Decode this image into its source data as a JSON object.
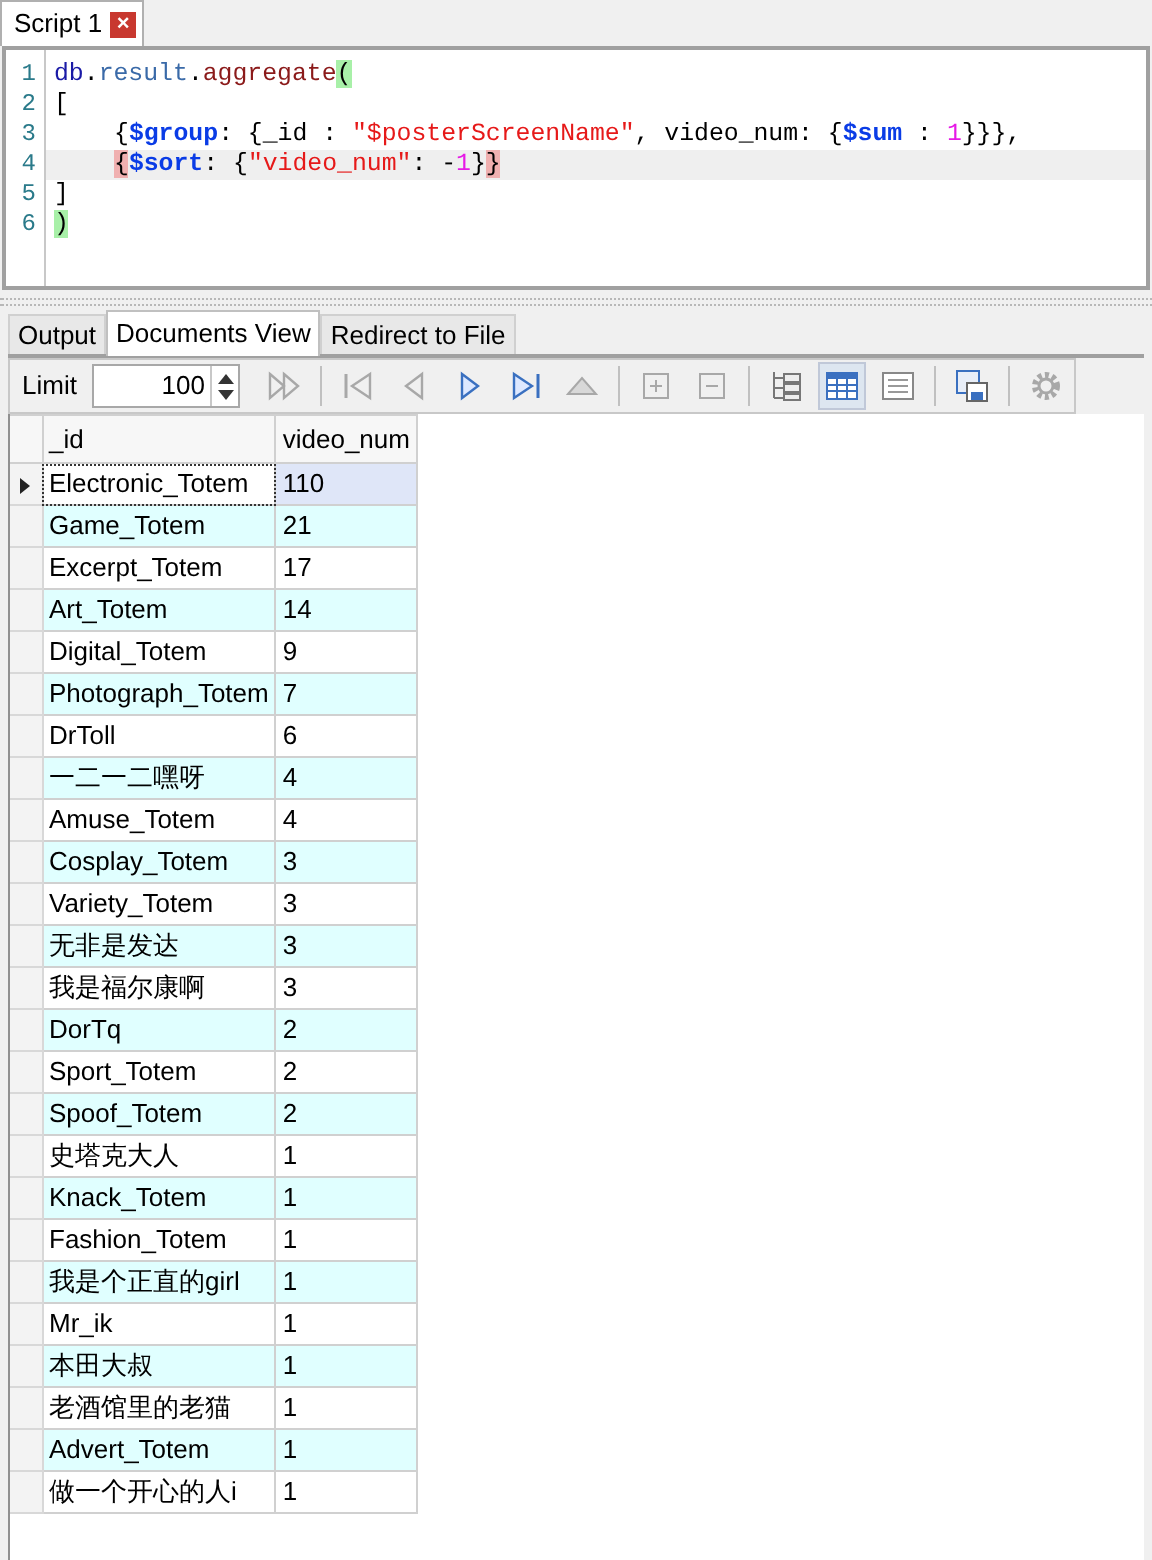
{
  "script_tab": {
    "label": "Script 1",
    "close": "×"
  },
  "editor": {
    "lines": [
      {
        "indented": false,
        "current": false,
        "tokens": [
          {
            "kind": "object",
            "text": "db"
          },
          {
            "kind": "punct",
            "text": "."
          },
          {
            "kind": "property",
            "text": "result"
          },
          {
            "kind": "punct",
            "text": "."
          },
          {
            "kind": "function",
            "text": "aggregate"
          },
          {
            "kind": "match",
            "text": "("
          }
        ]
      },
      {
        "indented": false,
        "current": false,
        "tokens": [
          {
            "kind": "punct",
            "text": "["
          }
        ]
      },
      {
        "indented": true,
        "current": false,
        "tokens": [
          {
            "kind": "punct",
            "text": "{"
          },
          {
            "kind": "key",
            "text": "$group"
          },
          {
            "kind": "punct",
            "text": ": {_id : "
          },
          {
            "kind": "string",
            "text": "\"$posterScreenName\""
          },
          {
            "kind": "punct",
            "text": ", video_num: {"
          },
          {
            "kind": "key",
            "text": "$sum"
          },
          {
            "kind": "punct",
            "text": " : "
          },
          {
            "kind": "number",
            "text": "1"
          },
          {
            "kind": "punct",
            "text": "}}},"
          }
        ]
      },
      {
        "indented": true,
        "current": true,
        "tokens": [
          {
            "kind": "mismatch",
            "text": "{"
          },
          {
            "kind": "key",
            "text": "$sort"
          },
          {
            "kind": "punct",
            "text": ": {"
          },
          {
            "kind": "string",
            "text": "\"video_num\""
          },
          {
            "kind": "punct",
            "text": ": -"
          },
          {
            "kind": "number",
            "text": "1"
          },
          {
            "kind": "punct",
            "text": "}"
          },
          {
            "kind": "mismatch",
            "text": "}"
          }
        ]
      },
      {
        "indented": false,
        "current": false,
        "tokens": [
          {
            "kind": "punct",
            "text": "]"
          }
        ]
      },
      {
        "indented": false,
        "current": false,
        "tokens": [
          {
            "kind": "match",
            "text": ")"
          }
        ]
      }
    ],
    "line_numbers": [
      "1",
      "2",
      "3",
      "4",
      "5",
      "6"
    ]
  },
  "result_tabs": [
    {
      "label": "Output",
      "selected": false
    },
    {
      "label": "Documents View",
      "selected": true
    },
    {
      "label": "Redirect to File",
      "selected": false
    }
  ],
  "toolbar": {
    "limit_label": "Limit",
    "limit_value": "100",
    "buttons": [
      {
        "kind": "fast-forward",
        "disabled": true
      },
      {
        "kind": "sep"
      },
      {
        "kind": "first",
        "disabled": true
      },
      {
        "kind": "previous",
        "disabled": true
      },
      {
        "kind": "next",
        "disabled": false
      },
      {
        "kind": "last",
        "disabled": false
      },
      {
        "kind": "up",
        "disabled": true
      },
      {
        "kind": "sep"
      },
      {
        "kind": "add",
        "disabled": true
      },
      {
        "kind": "remove",
        "disabled": true
      },
      {
        "kind": "sep"
      },
      {
        "kind": "tree",
        "selected": false
      },
      {
        "kind": "table",
        "selected": true
      },
      {
        "kind": "text",
        "selected": false
      },
      {
        "kind": "sep"
      },
      {
        "kind": "export",
        "disabled": false
      },
      {
        "kind": "sep"
      },
      {
        "kind": "settings",
        "disabled": true
      }
    ]
  },
  "table": {
    "columns": [
      "_id",
      "video_num"
    ],
    "rows": [
      {
        "_id": "Electronic_Totem",
        "video_num": "110",
        "selected": true
      },
      {
        "_id": "Game_Totem",
        "video_num": "21",
        "selected": false
      },
      {
        "_id": "Excerpt_Totem",
        "video_num": "17",
        "selected": false
      },
      {
        "_id": "Art_Totem",
        "video_num": "14",
        "selected": false
      },
      {
        "_id": "Digital_Totem",
        "video_num": "9",
        "selected": false
      },
      {
        "_id": "Photograph_Totem",
        "video_num": "7",
        "selected": false
      },
      {
        "_id": "DrToll",
        "video_num": "6",
        "selected": false
      },
      {
        "_id": "一二一二嘿呀",
        "video_num": "4",
        "selected": false
      },
      {
        "_id": "Amuse_Totem",
        "video_num": "4",
        "selected": false
      },
      {
        "_id": "Cosplay_Totem",
        "video_num": "3",
        "selected": false
      },
      {
        "_id": "Variety_Totem",
        "video_num": "3",
        "selected": false
      },
      {
        "_id": "无非是发达",
        "video_num": "3",
        "selected": false
      },
      {
        "_id": "我是福尔康啊",
        "video_num": "3",
        "selected": false
      },
      {
        "_id": "DorTq",
        "video_num": "2",
        "selected": false
      },
      {
        "_id": "Sport_Totem",
        "video_num": "2",
        "selected": false
      },
      {
        "_id": "Spoof_Totem",
        "video_num": "2",
        "selected": false
      },
      {
        "_id": "史塔克大人",
        "video_num": "1",
        "selected": false
      },
      {
        "_id": "Knack_Totem",
        "video_num": "1",
        "selected": false
      },
      {
        "_id": "Fashion_Totem",
        "video_num": "1",
        "selected": false
      },
      {
        "_id": "我是个正直的girl",
        "video_num": "1",
        "selected": false
      },
      {
        "_id": "Mr_ik",
        "video_num": "1",
        "selected": false
      },
      {
        "_id": "本田大叔",
        "video_num": "1",
        "selected": false
      },
      {
        "_id": "老酒馆里的老猫",
        "video_num": "1",
        "selected": false
      },
      {
        "_id": "Advert_Totem",
        "video_num": "1",
        "selected": false
      },
      {
        "_id": "做一个开心的人i",
        "video_num": "1",
        "selected": false
      }
    ]
  }
}
